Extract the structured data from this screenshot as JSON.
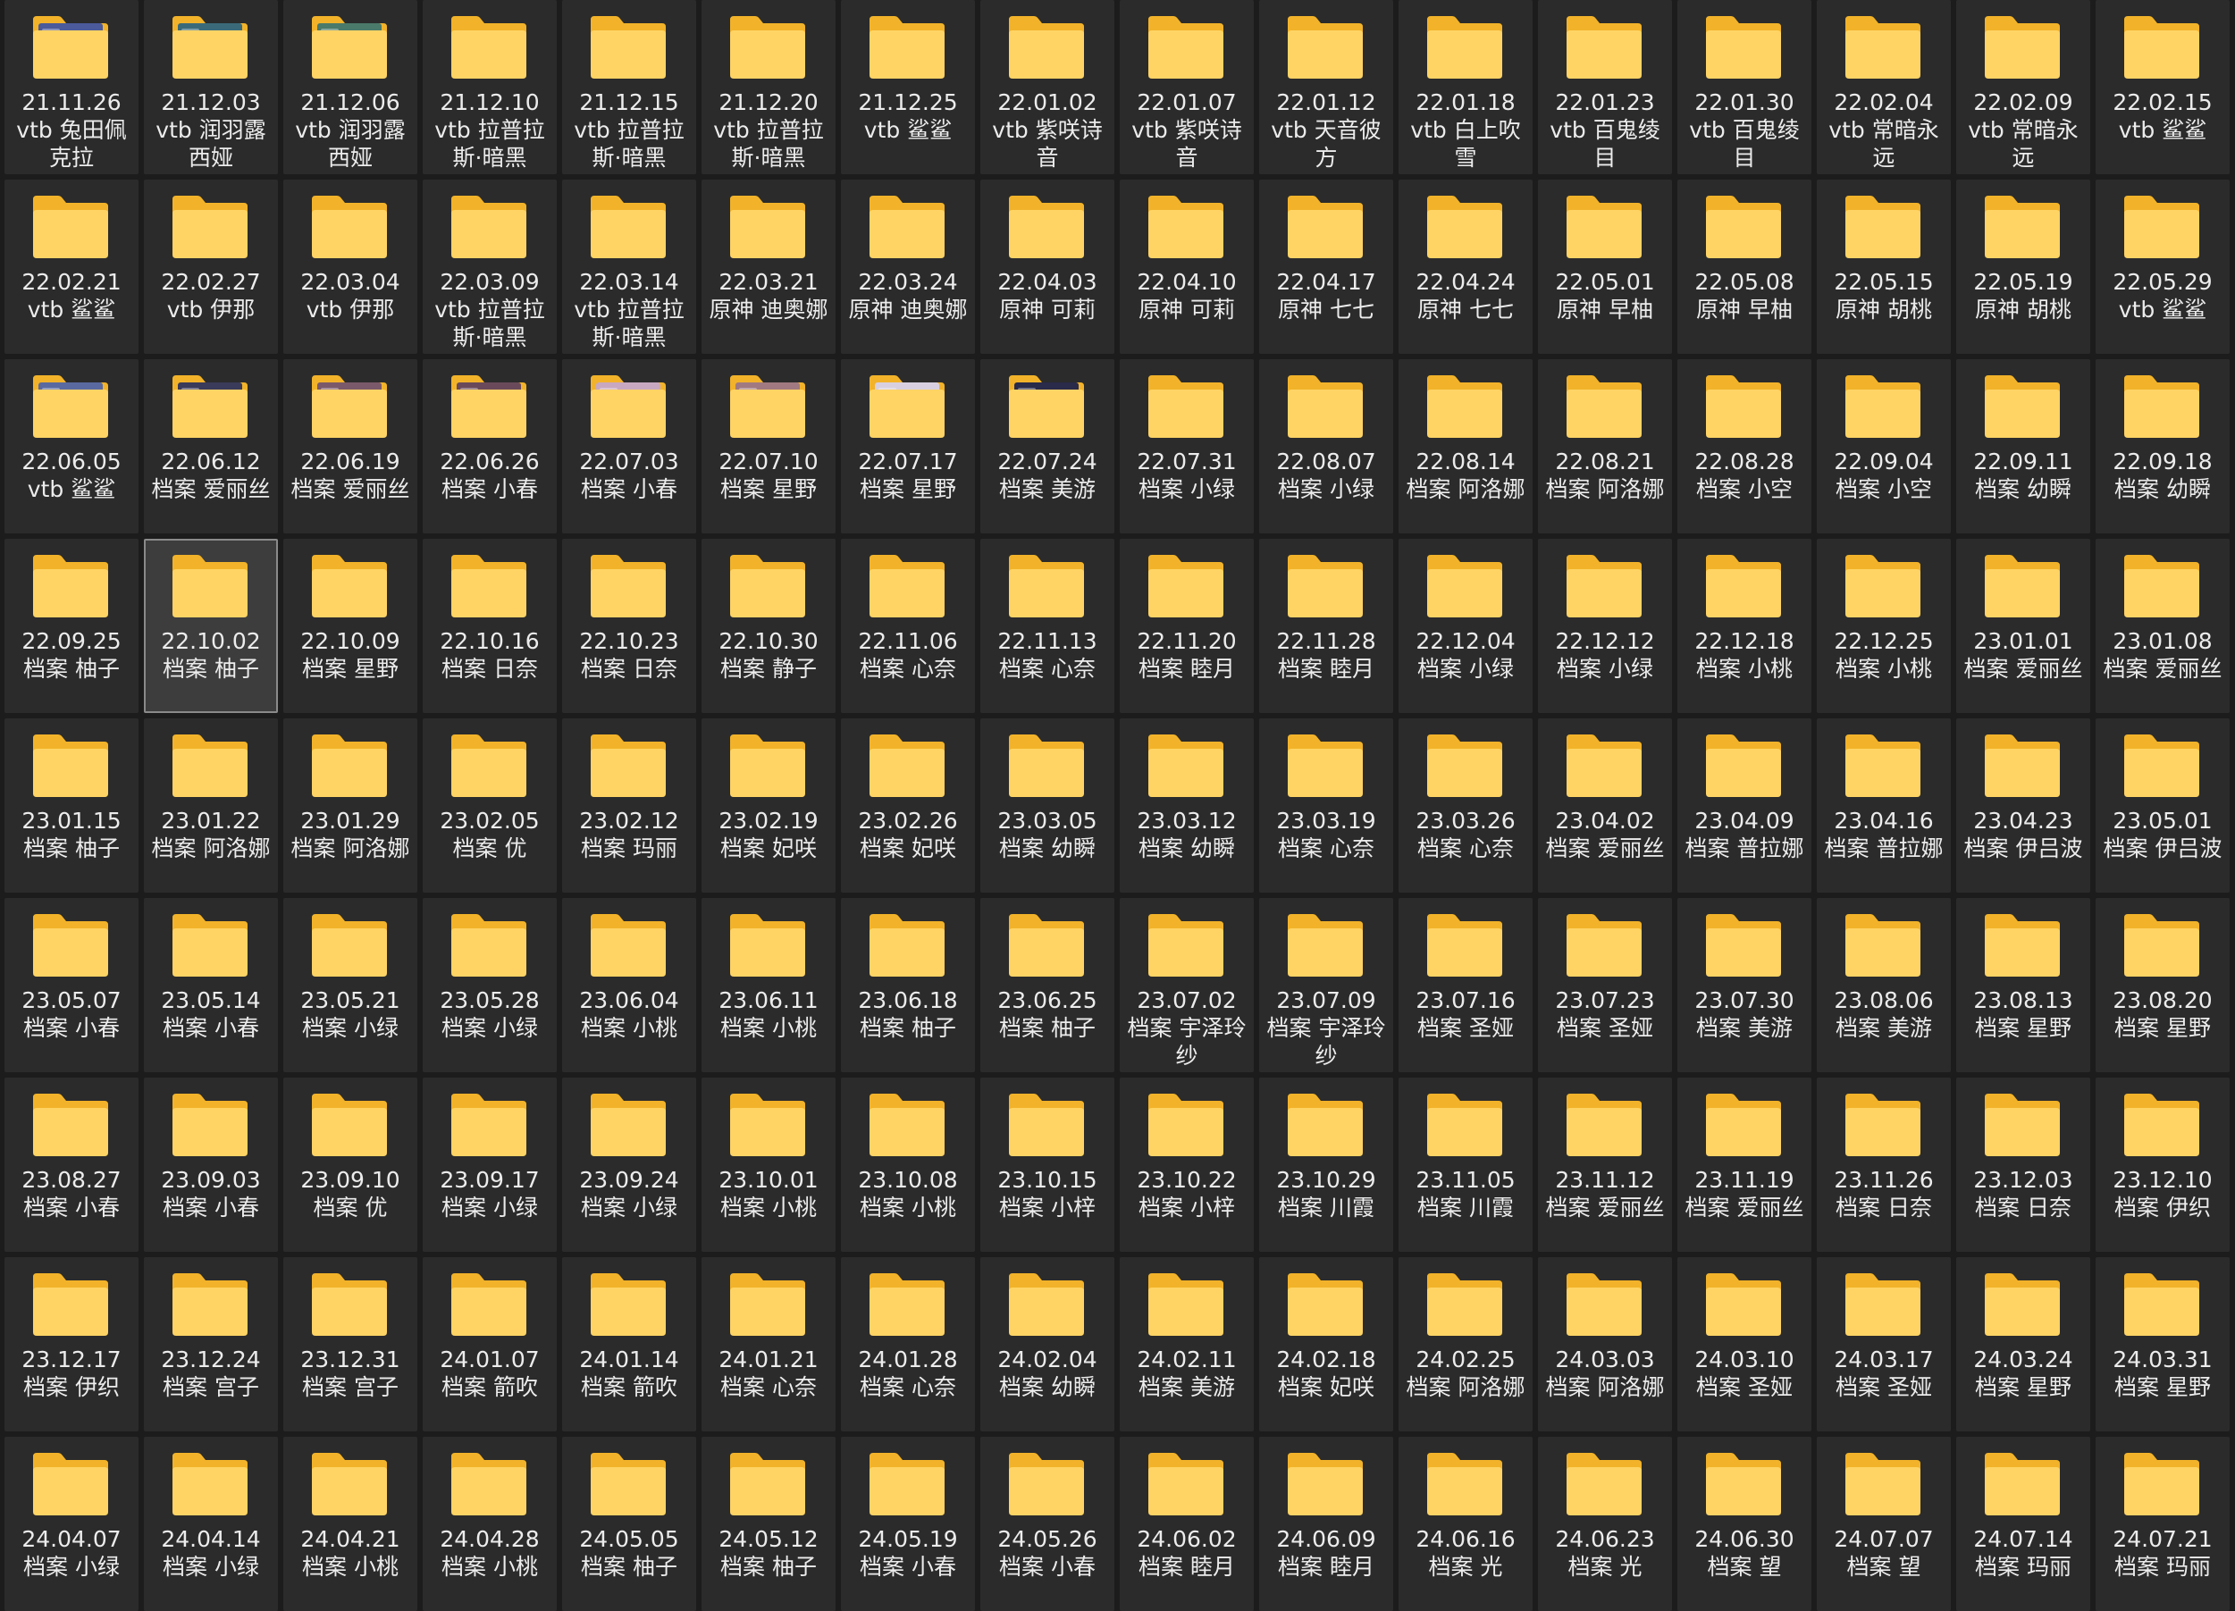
{
  "colors": {
    "background": "#1c1c1c",
    "tile": "#2b2b2b",
    "tile_selected": "#3d3d3d",
    "folder_back": "#f2b32a",
    "folder_front": "#ffd465",
    "label_text": "#ececec"
  },
  "selected_index": 49,
  "folders": [
    {
      "label": "21.11.26\nvtb 兔田佩克拉",
      "icon": "thumb-folder-icon",
      "thumb": "#4a5a9a"
    },
    {
      "label": "21.12.03\nvtb 润羽露西娅",
      "icon": "thumb-folder-icon",
      "thumb": "#3a6a7a"
    },
    {
      "label": "21.12.06\nvtb 润羽露西娅",
      "icon": "thumb-folder-icon",
      "thumb": "#4a7a6a"
    },
    {
      "label": "21.12.10\nvtb 拉普拉斯·暗黑",
      "icon": "blue-tab-folder-icon"
    },
    {
      "label": "21.12.15\nvtb 拉普拉斯·暗黑",
      "icon": "folder-icon"
    },
    {
      "label": "21.12.20\nvtb 拉普拉斯·暗黑",
      "icon": "folder-icon"
    },
    {
      "label": "21.12.25\nvtb 鲨鲨",
      "icon": "folder-icon"
    },
    {
      "label": "22.01.02\nvtb 紫咲诗音",
      "icon": "folder-icon"
    },
    {
      "label": "22.01.07\nvtb 紫咲诗音",
      "icon": "folder-icon"
    },
    {
      "label": "22.01.12\nvtb 天音彼方",
      "icon": "folder-icon"
    },
    {
      "label": "22.01.18\nvtb 白上吹雪",
      "icon": "folder-icon"
    },
    {
      "label": "22.01.23\nvtb 百鬼绫目",
      "icon": "folder-icon"
    },
    {
      "label": "22.01.30\nvtb 百鬼绫目",
      "icon": "folder-icon"
    },
    {
      "label": "22.02.04\nvtb 常暗永远",
      "icon": "folder-icon"
    },
    {
      "label": "22.02.09\nvtb 常暗永远",
      "icon": "folder-icon"
    },
    {
      "label": "22.02.15\nvtb 鲨鲨",
      "icon": "folder-icon"
    },
    {
      "label": "22.02.21\nvtb 鲨鲨",
      "icon": "folder-icon"
    },
    {
      "label": "22.02.27\nvtb 伊那",
      "icon": "folder-icon"
    },
    {
      "label": "22.03.04\nvtb 伊那",
      "icon": "folder-icon"
    },
    {
      "label": "22.03.09\nvtb 拉普拉斯·暗黑",
      "icon": "folder-icon"
    },
    {
      "label": "22.03.14\nvtb 拉普拉斯·暗黑",
      "icon": "folder-icon"
    },
    {
      "label": "22.03.21\n原神 迪奥娜",
      "icon": "folder-icon"
    },
    {
      "label": "22.03.24\n原神 迪奥娜",
      "icon": "folder-icon"
    },
    {
      "label": "22.04.03\n原神 可莉",
      "icon": "folder-icon"
    },
    {
      "label": "22.04.10\n原神 可莉",
      "icon": "folder-icon"
    },
    {
      "label": "22.04.17\n原神 七七",
      "icon": "folder-icon"
    },
    {
      "label": "22.04.24\n原神 七七",
      "icon": "blue-tab-folder-icon"
    },
    {
      "label": "22.05.01\n原神 早柚",
      "icon": "folder-icon"
    },
    {
      "label": "22.05.08\n原神 早柚",
      "icon": "folder-icon"
    },
    {
      "label": "22.05.15\n原神 胡桃",
      "icon": "folder-icon"
    },
    {
      "label": "22.05.19\n原神 胡桃",
      "icon": "folder-icon"
    },
    {
      "label": "22.05.29\nvtb 鲨鲨",
      "icon": "folder-icon"
    },
    {
      "label": "22.06.05\nvtb 鲨鲨",
      "icon": "thumb-folder-icon",
      "thumb": "#5a6aa0"
    },
    {
      "label": "22.06.12\n档案 爱丽丝",
      "icon": "thumb-folder-icon",
      "thumb": "#3a3a5a"
    },
    {
      "label": "22.06.19\n档案 爱丽丝",
      "icon": "thumb-folder-icon",
      "thumb": "#7a5a6a"
    },
    {
      "label": "22.06.26\n档案 小春",
      "icon": "thumb-folder-icon",
      "thumb": "#6a4a5a"
    },
    {
      "label": "22.07.03\n档案 小春",
      "icon": "thumb-folder-icon",
      "thumb": "#c8a8c0"
    },
    {
      "label": "22.07.10\n档案 星野",
      "icon": "thumb-folder-icon",
      "thumb": "#a07a80"
    },
    {
      "label": "22.07.17\n档案 星野",
      "icon": "thumb-folder-icon",
      "thumb": "#d8d0e0"
    },
    {
      "label": "22.07.24\n档案 美游",
      "icon": "thumb-folder-icon",
      "thumb": "#2a2a4a"
    },
    {
      "label": "22.07.31\n档案 小绿",
      "icon": "folder-icon"
    },
    {
      "label": "22.08.07\n档案 小绿",
      "icon": "folder-icon"
    },
    {
      "label": "22.08.14\n档案 阿洛娜",
      "icon": "folder-icon"
    },
    {
      "label": "22.08.21\n档案 阿洛娜",
      "icon": "folder-icon"
    },
    {
      "label": "22.08.28\n档案 小空",
      "icon": "folder-icon"
    },
    {
      "label": "22.09.04\n档案 小空",
      "icon": "folder-icon"
    },
    {
      "label": "22.09.11\n档案 幼瞬",
      "icon": "folder-icon"
    },
    {
      "label": "22.09.18\n档案 幼瞬",
      "icon": "folder-icon"
    },
    {
      "label": "22.09.25\n档案 柚子",
      "icon": "folder-icon"
    },
    {
      "label": "22.10.02\n档案 柚子",
      "icon": "folder-icon"
    },
    {
      "label": "22.10.09\n档案 星野",
      "icon": "folder-icon"
    },
    {
      "label": "22.10.16\n档案 日奈",
      "icon": "folder-icon"
    },
    {
      "label": "22.10.23\n档案 日奈",
      "icon": "folder-icon"
    },
    {
      "label": "22.10.30\n档案 静子",
      "icon": "folder-icon"
    },
    {
      "label": "22.11.06\n档案 心奈",
      "icon": "folder-icon"
    },
    {
      "label": "22.11.13\n档案 心奈",
      "icon": "folder-icon"
    },
    {
      "label": "22.11.20\n档案 睦月",
      "icon": "folder-icon"
    },
    {
      "label": "22.11.28\n档案 睦月",
      "icon": "folder-icon"
    },
    {
      "label": "22.12.04\n档案 小绿",
      "icon": "folder-icon"
    },
    {
      "label": "22.12.12\n档案 小绿",
      "icon": "folder-icon"
    },
    {
      "label": "22.12.18\n档案 小桃",
      "icon": "folder-icon"
    },
    {
      "label": "22.12.25\n档案 小桃",
      "icon": "folder-icon"
    },
    {
      "label": "23.01.01\n档案 爱丽丝",
      "icon": "folder-icon"
    },
    {
      "label": "23.01.08\n档案 爱丽丝",
      "icon": "folder-icon"
    },
    {
      "label": "23.01.15\n档案 柚子",
      "icon": "folder-icon"
    },
    {
      "label": "23.01.22\n档案 阿洛娜",
      "icon": "folder-icon"
    },
    {
      "label": "23.01.29\n档案 阿洛娜",
      "icon": "folder-icon"
    },
    {
      "label": "23.02.05\n档案 优",
      "icon": "folder-icon"
    },
    {
      "label": "23.02.12\n档案 玛丽",
      "icon": "folder-icon"
    },
    {
      "label": "23.02.19\n档案 妃咲",
      "icon": "folder-icon"
    },
    {
      "label": "23.02.26\n档案 妃咲",
      "icon": "folder-icon"
    },
    {
      "label": "23.03.05\n档案 幼瞬",
      "icon": "folder-icon"
    },
    {
      "label": "23.03.12\n档案 幼瞬",
      "icon": "folder-icon"
    },
    {
      "label": "23.03.19\n档案 心奈",
      "icon": "folder-icon"
    },
    {
      "label": "23.03.26\n档案 心奈",
      "icon": "folder-icon"
    },
    {
      "label": "23.04.02\n档案 爱丽丝",
      "icon": "folder-icon"
    },
    {
      "label": "23.04.09\n档案 普拉娜",
      "icon": "folder-icon"
    },
    {
      "label": "23.04.16\n档案 普拉娜",
      "icon": "folder-icon"
    },
    {
      "label": "23.04.23\n档案 伊吕波",
      "icon": "folder-icon"
    },
    {
      "label": "23.05.01\n档案 伊吕波",
      "icon": "folder-icon"
    },
    {
      "label": "23.05.07\n档案 小春",
      "icon": "folder-icon"
    },
    {
      "label": "23.05.14\n档案 小春",
      "icon": "folder-icon"
    },
    {
      "label": "23.05.21\n档案 小绿",
      "icon": "folder-icon"
    },
    {
      "label": "23.05.28\n档案 小绿",
      "icon": "folder-icon"
    },
    {
      "label": "23.06.04\n档案 小桃",
      "icon": "folder-icon"
    },
    {
      "label": "23.06.11\n档案 小桃",
      "icon": "folder-icon"
    },
    {
      "label": "23.06.18\n档案 柚子",
      "icon": "folder-icon"
    },
    {
      "label": "23.06.25\n档案 柚子",
      "icon": "folder-icon"
    },
    {
      "label": "23.07.02\n档案 宇泽玲纱",
      "icon": "folder-icon"
    },
    {
      "label": "23.07.09\n档案 宇泽玲纱",
      "icon": "folder-icon"
    },
    {
      "label": "23.07.16\n档案 圣娅",
      "icon": "folder-icon"
    },
    {
      "label": "23.07.23\n档案 圣娅",
      "icon": "folder-icon"
    },
    {
      "label": "23.07.30\n档案 美游",
      "icon": "folder-icon"
    },
    {
      "label": "23.08.06\n档案 美游",
      "icon": "folder-icon"
    },
    {
      "label": "23.08.13\n档案 星野",
      "icon": "folder-icon"
    },
    {
      "label": "23.08.20\n档案 星野",
      "icon": "folder-icon"
    },
    {
      "label": "23.08.27\n档案 小春",
      "icon": "folder-icon"
    },
    {
      "label": "23.09.03\n档案 小春",
      "icon": "folder-icon"
    },
    {
      "label": "23.09.10\n档案 优",
      "icon": "folder-icon"
    },
    {
      "label": "23.09.17\n档案 小绿",
      "icon": "folder-icon"
    },
    {
      "label": "23.09.24\n档案 小绿",
      "icon": "folder-icon"
    },
    {
      "label": "23.10.01\n档案 小桃",
      "icon": "folder-icon"
    },
    {
      "label": "23.10.08\n档案 小桃",
      "icon": "folder-icon"
    },
    {
      "label": "23.10.15\n档案 小梓",
      "icon": "folder-icon"
    },
    {
      "label": "23.10.22\n档案 小梓",
      "icon": "folder-icon"
    },
    {
      "label": "23.10.29\n档案 川霞",
      "icon": "folder-icon"
    },
    {
      "label": "23.11.05\n档案 川霞",
      "icon": "folder-icon"
    },
    {
      "label": "23.11.12\n档案 爱丽丝",
      "icon": "folder-icon"
    },
    {
      "label": "23.11.19\n档案 爱丽丝",
      "icon": "folder-icon"
    },
    {
      "label": "23.11.26\n档案 日奈",
      "icon": "folder-icon"
    },
    {
      "label": "23.12.03\n档案 日奈",
      "icon": "folder-icon"
    },
    {
      "label": "23.12.10\n档案 伊织",
      "icon": "folder-icon"
    },
    {
      "label": "23.12.17\n档案 伊织",
      "icon": "folder-icon"
    },
    {
      "label": "23.12.24\n档案 宫子",
      "icon": "folder-icon"
    },
    {
      "label": "23.12.31\n档案 宫子",
      "icon": "folder-icon"
    },
    {
      "label": "24.01.07\n档案 箭吹",
      "icon": "folder-icon"
    },
    {
      "label": "24.01.14\n档案 箭吹",
      "icon": "folder-icon"
    },
    {
      "label": "24.01.21\n档案 心奈",
      "icon": "folder-icon"
    },
    {
      "label": "24.01.28\n档案 心奈",
      "icon": "folder-icon"
    },
    {
      "label": "24.02.04\n档案 幼瞬",
      "icon": "folder-icon"
    },
    {
      "label": "24.02.11\n档案 美游",
      "icon": "folder-icon"
    },
    {
      "label": "24.02.18\n档案 妃咲",
      "icon": "folder-icon"
    },
    {
      "label": "24.02.25\n档案 阿洛娜",
      "icon": "folder-icon"
    },
    {
      "label": "24.03.03\n档案 阿洛娜",
      "icon": "folder-icon"
    },
    {
      "label": "24.03.10\n档案 圣娅",
      "icon": "folder-icon"
    },
    {
      "label": "24.03.17\n档案 圣娅",
      "icon": "folder-icon"
    },
    {
      "label": "24.03.24\n档案 星野",
      "icon": "folder-icon"
    },
    {
      "label": "24.03.31\n档案 星野",
      "icon": "folder-icon"
    },
    {
      "label": "24.04.07\n档案 小绿",
      "icon": "folder-icon"
    },
    {
      "label": "24.04.14\n档案 小绿",
      "icon": "folder-icon"
    },
    {
      "label": "24.04.21\n档案 小桃",
      "icon": "folder-icon"
    },
    {
      "label": "24.04.28\n档案 小桃",
      "icon": "folder-icon"
    },
    {
      "label": "24.05.05\n档案 柚子",
      "icon": "folder-icon"
    },
    {
      "label": "24.05.12\n档案 柚子",
      "icon": "folder-icon"
    },
    {
      "label": "24.05.19\n档案 小春",
      "icon": "folder-icon"
    },
    {
      "label": "24.05.26\n档案 小春",
      "icon": "folder-icon"
    },
    {
      "label": "24.06.02\n档案 睦月",
      "icon": "folder-icon"
    },
    {
      "label": "24.06.09\n档案 睦月",
      "icon": "folder-icon"
    },
    {
      "label": "24.06.16\n档案 光",
      "icon": "folder-icon"
    },
    {
      "label": "24.06.23\n档案 光",
      "icon": "folder-icon"
    },
    {
      "label": "24.06.30\n档案 望",
      "icon": "folder-icon"
    },
    {
      "label": "24.07.07\n档案 望",
      "icon": "folder-icon"
    },
    {
      "label": "24.07.14\n档案 玛丽",
      "icon": "folder-icon"
    },
    {
      "label": "24.07.21\n档案 玛丽",
      "icon": "folder-icon"
    }
  ]
}
